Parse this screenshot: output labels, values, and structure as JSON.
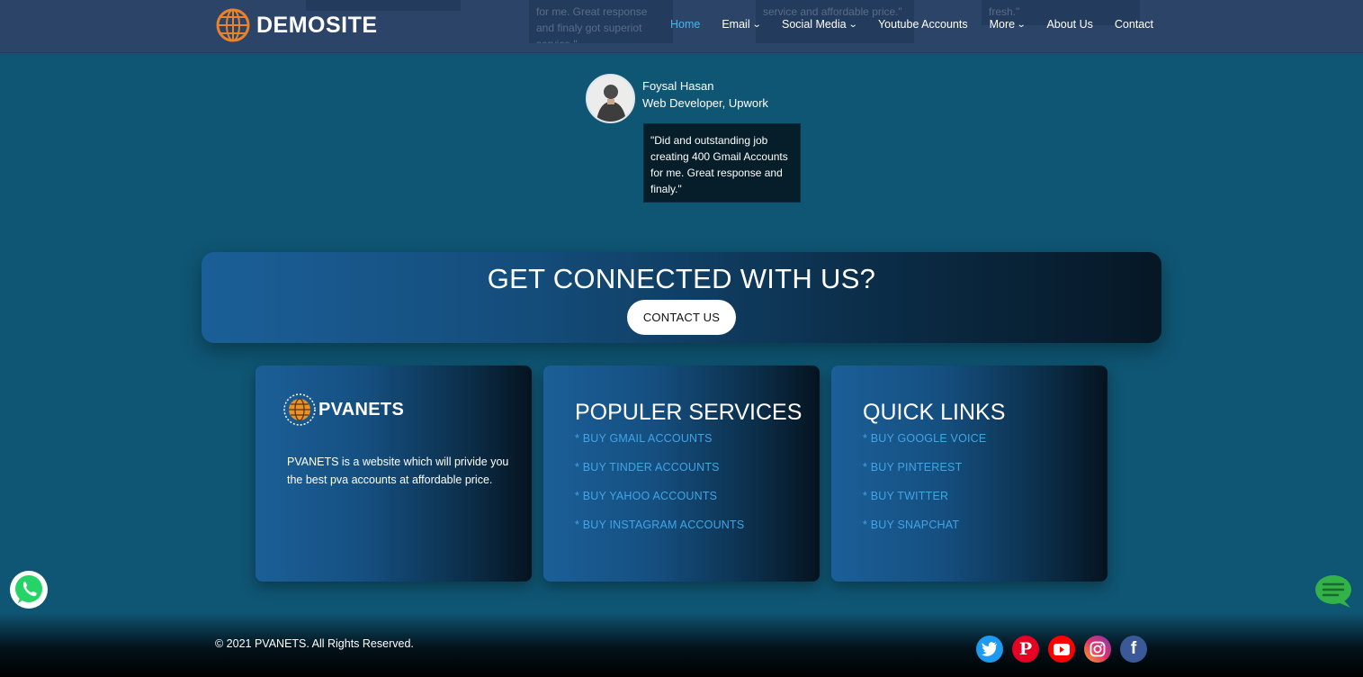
{
  "header": {
    "brand": "DEMOSITE",
    "ghost_texts": [
      "",
      "for me. Great response and finaly got superiot service.\"",
      "service and affordable price.\"",
      "fresh.\""
    ],
    "nav": [
      {
        "label": "Home",
        "active": true,
        "dropdown": false
      },
      {
        "label": "Email",
        "active": false,
        "dropdown": true
      },
      {
        "label": "Social Media",
        "active": false,
        "dropdown": true
      },
      {
        "label": "Youtube Accounts",
        "active": false,
        "dropdown": false
      },
      {
        "label": "More",
        "active": false,
        "dropdown": true
      },
      {
        "label": "About Us",
        "active": false,
        "dropdown": false
      },
      {
        "label": "Contact",
        "active": false,
        "dropdown": false
      }
    ]
  },
  "testimonial": {
    "name": "Foysal Hasan",
    "role": "Web Developer, Upwork",
    "quote": "\"Did and outstanding job creating 400 Gmail Accounts for me. Great response and finaly.\""
  },
  "cta": {
    "title": "GET CONNECTED WITH US?",
    "button": "CONTACT US"
  },
  "about": {
    "brand": "PVANETS",
    "text": "PVANETS is a website which will privide you the best pva accounts at affordable price."
  },
  "services": {
    "title": "POPULER SERVICES",
    "items": [
      "* BUY GMAIL ACCOUNTS",
      "* BUY TINDER ACCOUNTS",
      "* BUY YAHOO ACCOUNTS",
      "* BUY INSTAGRAM ACCOUNTS"
    ]
  },
  "quick_links": {
    "title": "QUICK LINKS",
    "items": [
      "* BUY GOOGLE VOICE",
      "* BUY PINTEREST",
      "* BUY TWITTER",
      "* BUY SNAPCHAT"
    ]
  },
  "footer": {
    "copyright": "© 2021 PVANETS. All Rights Reserved.",
    "socials": [
      {
        "icon": "twitter-icon",
        "color": "#1d9bf0"
      },
      {
        "icon": "pinterest-icon",
        "color": "#e60023"
      },
      {
        "icon": "youtube-icon",
        "color": "#ff0000"
      },
      {
        "icon": "instagram-icon",
        "color": "#d6249f"
      },
      {
        "icon": "facebook-icon",
        "color": "#3b5998"
      }
    ]
  },
  "colors": {
    "page_bg": "#0f5674",
    "header_bg": "#2b4467",
    "accent": "#41a4e6",
    "logo_orange": "#e8822b"
  }
}
